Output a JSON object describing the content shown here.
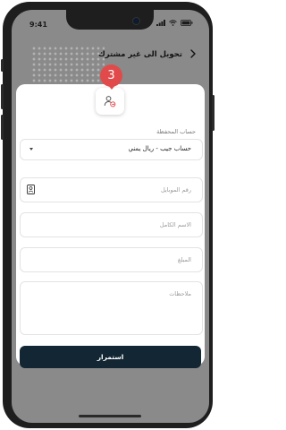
{
  "status_bar": {
    "time": "9:41"
  },
  "header": {
    "title": "تحويل الى غير مشترك"
  },
  "step_badge": "3",
  "form": {
    "wallet_account": {
      "label": "حساب المحفظة",
      "value": "حساب جيب - ريال يمني"
    },
    "mobile_number": {
      "placeholder": "رقم الموبايل"
    },
    "full_name": {
      "placeholder": "الاسم الكامل"
    },
    "amount": {
      "placeholder": "المبلغ"
    },
    "notes": {
      "placeholder": "ملاحظات"
    },
    "submit_label": "استمرار"
  },
  "colors": {
    "accent": "#132633",
    "badge": "#e14a4a"
  },
  "icons": [
    "signal-icon",
    "wifi-icon",
    "battery-icon",
    "back-arrow-icon",
    "transfer-user-icon",
    "contact-book-icon",
    "chevron-down-icon"
  ]
}
